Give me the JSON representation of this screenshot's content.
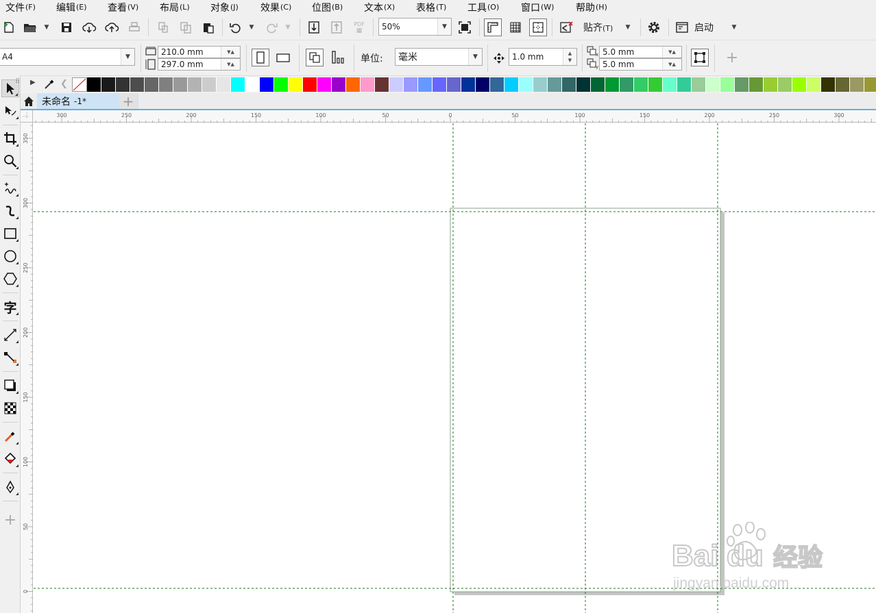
{
  "menu": [
    {
      "label": "文件",
      "acc": "(F)"
    },
    {
      "label": "编辑",
      "acc": "(E)"
    },
    {
      "label": "查看",
      "acc": "(V)"
    },
    {
      "label": "布局",
      "acc": "(L)"
    },
    {
      "label": "对象",
      "acc": "(J)"
    },
    {
      "label": "效果",
      "acc": "(C)"
    },
    {
      "label": "位图",
      "acc": "(B)"
    },
    {
      "label": "文本",
      "acc": "(X)"
    },
    {
      "label": "表格",
      "acc": "(T)"
    },
    {
      "label": "工具",
      "acc": "(O)"
    },
    {
      "label": "窗口",
      "acc": "(W)"
    },
    {
      "label": "帮助",
      "acc": "(H)"
    }
  ],
  "standard_toolbar": {
    "zoom_value": "50%",
    "snap_label": "贴齐",
    "snap_acc": "(T)",
    "launch_label": "启动",
    "pdf_label": "PDF"
  },
  "property_bar": {
    "page_size": "A4",
    "width": "210.0 mm",
    "height": "297.0 mm",
    "units_label": "单位:",
    "units_value": "毫米",
    "nudge": "1.0 mm",
    "dup_x": "5.0 mm",
    "dup_y": "5.0 mm"
  },
  "document_tab": {
    "title": "未命名",
    "modified": "-1*"
  },
  "palette": {
    "colors": [
      "#000000",
      "#1a1a1a",
      "#333333",
      "#4d4d4d",
      "#666666",
      "#808080",
      "#999999",
      "#b3b3b3",
      "#cccccc",
      "#e6e6e6",
      "#00ffff",
      "#ffffff",
      "#0000ff",
      "#00ff00",
      "#ffff00",
      "#ff0000",
      "#ff00ff",
      "#9900cc",
      "#ff6600",
      "#ff99cc",
      "#663333",
      "#ccccff",
      "#9999ff",
      "#6699ff",
      "#6666ff",
      "#6666cc",
      "#003399",
      "#000066",
      "#336699",
      "#00ccff",
      "#99ffff",
      "#99cccc",
      "#669999",
      "#336666",
      "#003333",
      "#006633",
      "#009933",
      "#339966",
      "#33cc66",
      "#33cc33",
      "#66ffcc",
      "#33cc99",
      "#99cc99",
      "#ccffcc",
      "#99ff99",
      "#669966",
      "#669933",
      "#99cc33",
      "#99cc66",
      "#99ff00",
      "#ccff66",
      "#333300",
      "#666633",
      "#999966",
      "#999933"
    ]
  },
  "rulers": {
    "horizontal_labels": [
      "300",
      "250",
      "200",
      "150",
      "100",
      "50",
      "0",
      "50",
      "100",
      "150",
      "200",
      "250",
      "300"
    ],
    "vertical_labels": [
      "350",
      "300",
      "250",
      "200",
      "150",
      "100",
      "50",
      "0"
    ],
    "units": "mm"
  },
  "toolbox": {
    "text_tool_glyph": "字"
  },
  "watermark": {
    "brand": "Bai",
    "brand2": "du",
    "cn": "经验",
    "url": "jingyan.baidu.com"
  }
}
